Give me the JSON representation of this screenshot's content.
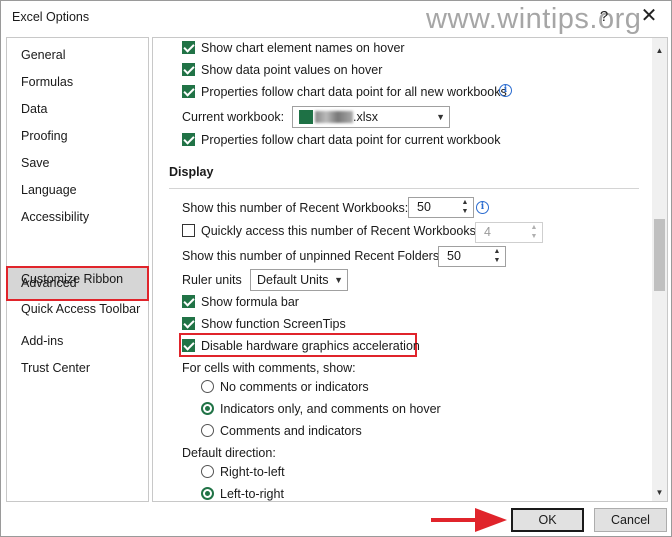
{
  "window": {
    "title": "Excel Options",
    "help_glyph": "?",
    "close_glyph": "✕",
    "watermark": "www.wintips.org"
  },
  "sidebar": {
    "items": [
      {
        "label": "General"
      },
      {
        "label": "Formulas"
      },
      {
        "label": "Data"
      },
      {
        "label": "Proofing"
      },
      {
        "label": "Save"
      },
      {
        "label": "Language"
      },
      {
        "label": "Accessibility"
      },
      {
        "label": "Advanced",
        "selected": true
      },
      {
        "label": "Customize Ribbon"
      },
      {
        "label": "Quick Access Toolbar"
      },
      {
        "label": "Add-ins"
      },
      {
        "label": "Trust Center"
      }
    ]
  },
  "chart_section": {
    "show_element_names": {
      "label": "Show chart element names on hover",
      "checked": true
    },
    "show_data_point_values": {
      "label": "Show data point values on hover",
      "checked": true
    },
    "properties_follow_all": {
      "label": "Properties follow chart data point for all new workbooks",
      "checked": true
    },
    "current_workbook_label": "Current workbook:",
    "current_workbook_value": ".xlsx",
    "properties_follow_current": {
      "label": "Properties follow chart data point for current workbook",
      "checked": true
    }
  },
  "display_section": {
    "heading": "Display",
    "recent_workbooks_label": "Show this number of Recent Workbooks:",
    "recent_workbooks_value": "50",
    "quick_access_label": "Quickly access this number of Recent Workbooks:",
    "quick_access_checked": false,
    "quick_access_value": "4",
    "unpinned_folders_label": "Show this number of unpinned Recent Folders:",
    "unpinned_folders_value": "50",
    "ruler_units_label": "Ruler units",
    "ruler_units_value": "Default Units",
    "show_formula_bar": {
      "label": "Show formula bar",
      "checked": true
    },
    "show_function_screentips": {
      "label": "Show function ScreenTips",
      "checked": true
    },
    "disable_hw_accel": {
      "label": "Disable hardware graphics acceleration",
      "checked": true
    },
    "comments_heading": "For cells with comments, show:",
    "comments_options": [
      {
        "label": "No comments or indicators",
        "checked": false
      },
      {
        "label": "Indicators only, and comments on hover",
        "checked": true
      },
      {
        "label": "Comments and indicators",
        "checked": false
      }
    ],
    "direction_heading": "Default direction:",
    "direction_options": [
      {
        "label": "Right-to-left",
        "checked": false
      },
      {
        "label": "Left-to-right",
        "checked": true
      }
    ]
  },
  "footer": {
    "ok_label": "OK",
    "cancel_label": "Cancel"
  },
  "colors": {
    "accent_green": "#217346",
    "highlight_red": "#e0242b"
  }
}
